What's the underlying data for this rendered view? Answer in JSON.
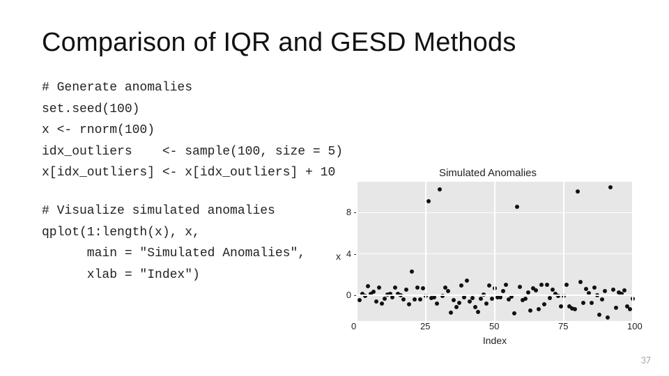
{
  "title": "Comparison of IQR and GESD Methods",
  "code_block_1": "# Generate anomalies\nset.seed(100)\nx <- rnorm(100)\nidx_outliers    <- sample(100, size = 5)\nx[idx_outliers] <- x[idx_outliers] + 10",
  "code_block_2": "# Visualize simulated anomalies\nqplot(1:length(x), x,\n      main = \"Simulated Anomalies\",\n      xlab = \"Index\")",
  "page_number": "37",
  "chart_data": {
    "type": "scatter",
    "title": "Simulated Anomalies",
    "xlabel": "Index",
    "ylabel": "x",
    "xlim": [
      0,
      100
    ],
    "ylim": [
      -2.5,
      11
    ],
    "x_ticks": [
      0,
      25,
      50,
      75,
      100
    ],
    "y_ticks": [
      0,
      4,
      8
    ],
    "description": "100 points from rnorm(100). Five indices have +10 added (outliers near y≈8–11). Remaining points cluster roughly between -2 and 2.",
    "x": [
      1,
      2,
      3,
      4,
      5,
      6,
      7,
      8,
      9,
      10,
      11,
      12,
      13,
      14,
      15,
      16,
      17,
      18,
      19,
      20,
      21,
      22,
      23,
      24,
      25,
      26,
      27,
      28,
      29,
      30,
      31,
      32,
      33,
      34,
      35,
      36,
      37,
      38,
      39,
      40,
      41,
      42,
      43,
      44,
      45,
      46,
      47,
      48,
      49,
      50,
      51,
      52,
      53,
      54,
      55,
      56,
      57,
      58,
      59,
      60,
      61,
      62,
      63,
      64,
      65,
      66,
      67,
      68,
      69,
      70,
      71,
      72,
      73,
      74,
      75,
      76,
      77,
      78,
      79,
      80,
      81,
      82,
      83,
      84,
      85,
      86,
      87,
      88,
      89,
      90,
      91,
      92,
      93,
      94,
      95,
      96,
      97,
      98,
      99,
      100
    ],
    "y": [
      -0.5,
      0.13,
      -0.08,
      0.89,
      0.12,
      0.32,
      -0.58,
      0.71,
      -0.83,
      -0.36,
      0.09,
      0.1,
      -0.2,
      0.74,
      0.12,
      -0.03,
      -0.39,
      0.51,
      -0.91,
      2.31,
      -0.44,
      0.76,
      -0.43,
      0.7,
      -0.06,
      9.1,
      -0.28,
      -0.19,
      -0.8,
      10.25,
      -0.1,
      0.76,
      0.39,
      -1.66,
      -0.46,
      -1.12,
      -0.75,
      0.91,
      -0.19,
      1.4,
      -0.59,
      -0.28,
      -1.18,
      -1.59,
      -0.31,
      0.06,
      -0.84,
      0.97,
      -0.32,
      0.7,
      -0.19,
      -0.23,
      0.39,
      1.04,
      -0.42,
      -0.17,
      -1.78,
      8.54,
      0.82,
      -0.45,
      -0.37,
      0.24,
      -1.5,
      0.7,
      0.47,
      -1.32,
      1.02,
      -0.89,
      1.01,
      -0.3,
      0.56,
      0.15,
      -0.05,
      -1.09,
      -0.07,
      1.0,
      -1.08,
      -1.28,
      -1.38,
      10.04,
      1.25,
      -0.73,
      0.62,
      0.22,
      -0.74,
      0.73,
      -0.01,
      -1.86,
      -0.39,
      0.39,
      -2.19,
      10.44,
      0.53,
      -1.19,
      0.24,
      0.16,
      0.5,
      -1.07,
      -1.34,
      -0.36
    ]
  }
}
